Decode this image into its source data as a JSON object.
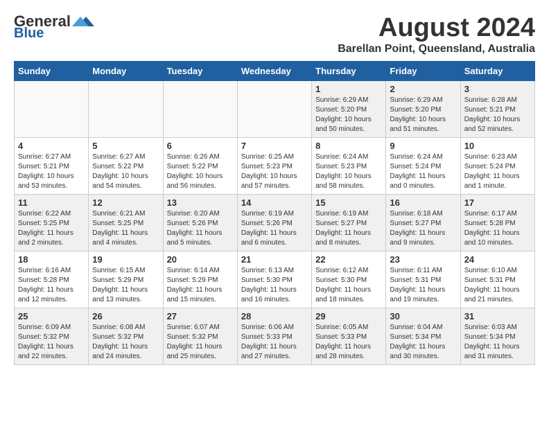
{
  "header": {
    "logo_general": "General",
    "logo_blue": "Blue",
    "month_year": "August 2024",
    "location": "Barellan Point, Queensland, Australia"
  },
  "weekdays": [
    "Sunday",
    "Monday",
    "Tuesday",
    "Wednesday",
    "Thursday",
    "Friday",
    "Saturday"
  ],
  "weeks": [
    [
      {
        "day": "",
        "info": ""
      },
      {
        "day": "",
        "info": ""
      },
      {
        "day": "",
        "info": ""
      },
      {
        "day": "",
        "info": ""
      },
      {
        "day": "1",
        "info": "Sunrise: 6:29 AM\nSunset: 5:20 PM\nDaylight: 10 hours\nand 50 minutes."
      },
      {
        "day": "2",
        "info": "Sunrise: 6:29 AM\nSunset: 5:20 PM\nDaylight: 10 hours\nand 51 minutes."
      },
      {
        "day": "3",
        "info": "Sunrise: 6:28 AM\nSunset: 5:21 PM\nDaylight: 10 hours\nand 52 minutes."
      }
    ],
    [
      {
        "day": "4",
        "info": "Sunrise: 6:27 AM\nSunset: 5:21 PM\nDaylight: 10 hours\nand 53 minutes."
      },
      {
        "day": "5",
        "info": "Sunrise: 6:27 AM\nSunset: 5:22 PM\nDaylight: 10 hours\nand 54 minutes."
      },
      {
        "day": "6",
        "info": "Sunrise: 6:26 AM\nSunset: 5:22 PM\nDaylight: 10 hours\nand 56 minutes."
      },
      {
        "day": "7",
        "info": "Sunrise: 6:25 AM\nSunset: 5:23 PM\nDaylight: 10 hours\nand 57 minutes."
      },
      {
        "day": "8",
        "info": "Sunrise: 6:24 AM\nSunset: 5:23 PM\nDaylight: 10 hours\nand 58 minutes."
      },
      {
        "day": "9",
        "info": "Sunrise: 6:24 AM\nSunset: 5:24 PM\nDaylight: 11 hours\nand 0 minutes."
      },
      {
        "day": "10",
        "info": "Sunrise: 6:23 AM\nSunset: 5:24 PM\nDaylight: 11 hours\nand 1 minute."
      }
    ],
    [
      {
        "day": "11",
        "info": "Sunrise: 6:22 AM\nSunset: 5:25 PM\nDaylight: 11 hours\nand 2 minutes."
      },
      {
        "day": "12",
        "info": "Sunrise: 6:21 AM\nSunset: 5:25 PM\nDaylight: 11 hours\nand 4 minutes."
      },
      {
        "day": "13",
        "info": "Sunrise: 6:20 AM\nSunset: 5:26 PM\nDaylight: 11 hours\nand 5 minutes."
      },
      {
        "day": "14",
        "info": "Sunrise: 6:19 AM\nSunset: 5:26 PM\nDaylight: 11 hours\nand 6 minutes."
      },
      {
        "day": "15",
        "info": "Sunrise: 6:19 AM\nSunset: 5:27 PM\nDaylight: 11 hours\nand 8 minutes."
      },
      {
        "day": "16",
        "info": "Sunrise: 6:18 AM\nSunset: 5:27 PM\nDaylight: 11 hours\nand 9 minutes."
      },
      {
        "day": "17",
        "info": "Sunrise: 6:17 AM\nSunset: 5:28 PM\nDaylight: 11 hours\nand 10 minutes."
      }
    ],
    [
      {
        "day": "18",
        "info": "Sunrise: 6:16 AM\nSunset: 5:28 PM\nDaylight: 11 hours\nand 12 minutes."
      },
      {
        "day": "19",
        "info": "Sunrise: 6:15 AM\nSunset: 5:29 PM\nDaylight: 11 hours\nand 13 minutes."
      },
      {
        "day": "20",
        "info": "Sunrise: 6:14 AM\nSunset: 5:29 PM\nDaylight: 11 hours\nand 15 minutes."
      },
      {
        "day": "21",
        "info": "Sunrise: 6:13 AM\nSunset: 5:30 PM\nDaylight: 11 hours\nand 16 minutes."
      },
      {
        "day": "22",
        "info": "Sunrise: 6:12 AM\nSunset: 5:30 PM\nDaylight: 11 hours\nand 18 minutes."
      },
      {
        "day": "23",
        "info": "Sunrise: 6:11 AM\nSunset: 5:31 PM\nDaylight: 11 hours\nand 19 minutes."
      },
      {
        "day": "24",
        "info": "Sunrise: 6:10 AM\nSunset: 5:31 PM\nDaylight: 11 hours\nand 21 minutes."
      }
    ],
    [
      {
        "day": "25",
        "info": "Sunrise: 6:09 AM\nSunset: 5:32 PM\nDaylight: 11 hours\nand 22 minutes."
      },
      {
        "day": "26",
        "info": "Sunrise: 6:08 AM\nSunset: 5:32 PM\nDaylight: 11 hours\nand 24 minutes."
      },
      {
        "day": "27",
        "info": "Sunrise: 6:07 AM\nSunset: 5:32 PM\nDaylight: 11 hours\nand 25 minutes."
      },
      {
        "day": "28",
        "info": "Sunrise: 6:06 AM\nSunset: 5:33 PM\nDaylight: 11 hours\nand 27 minutes."
      },
      {
        "day": "29",
        "info": "Sunrise: 6:05 AM\nSunset: 5:33 PM\nDaylight: 11 hours\nand 28 minutes."
      },
      {
        "day": "30",
        "info": "Sunrise: 6:04 AM\nSunset: 5:34 PM\nDaylight: 11 hours\nand 30 minutes."
      },
      {
        "day": "31",
        "info": "Sunrise: 6:03 AM\nSunset: 5:34 PM\nDaylight: 11 hours\nand 31 minutes."
      }
    ]
  ]
}
